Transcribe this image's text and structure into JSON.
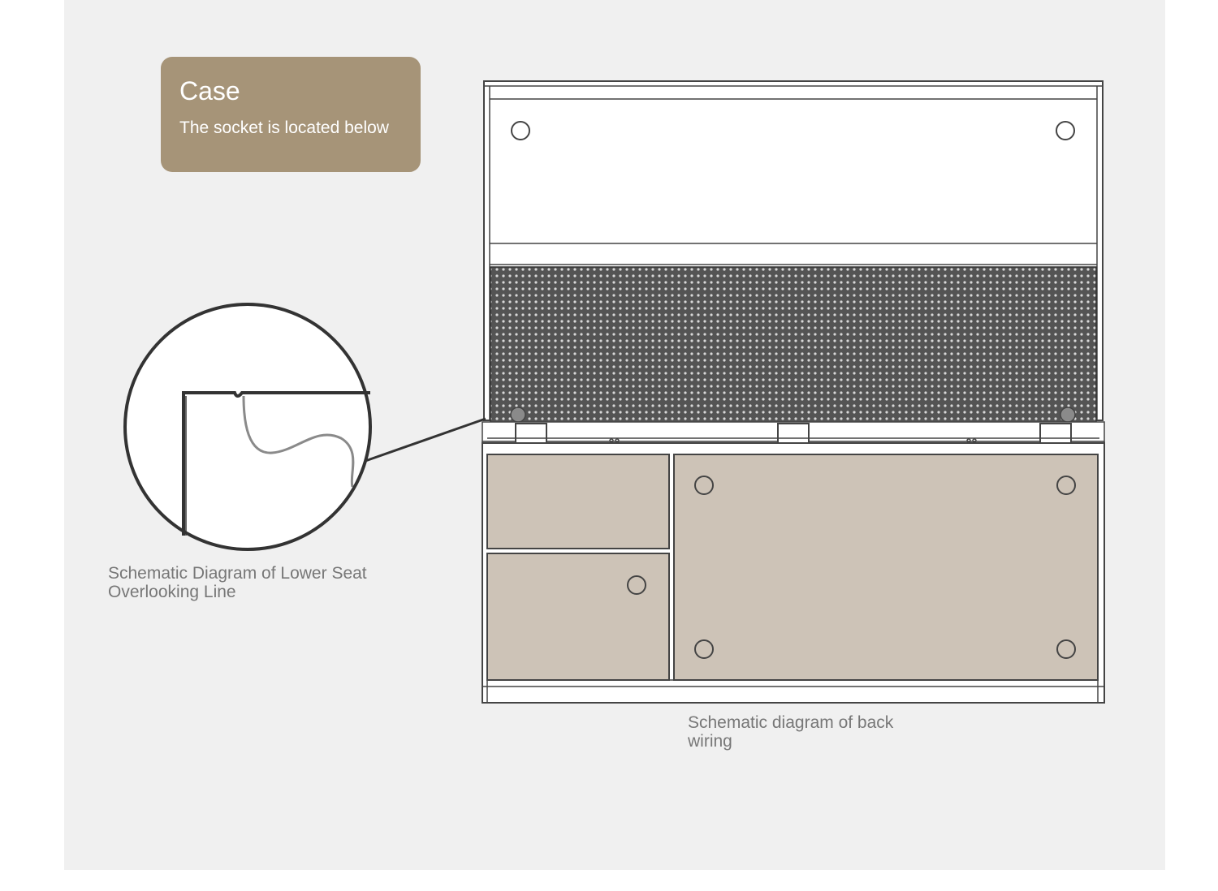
{
  "callout": {
    "title": "Case",
    "text": "The socket is located below"
  },
  "captions": {
    "zoom_detail": "Schematic Diagram of Lower Seat Overlooking Line",
    "back_view": "Schematic diagram of back wiring"
  },
  "colors": {
    "background": "#f0f0f0",
    "callout": "#a69478",
    "panel_fill": "#cdc3b7",
    "outline": "#444444",
    "pegboard": "#545454",
    "caption_text": "#777777"
  }
}
